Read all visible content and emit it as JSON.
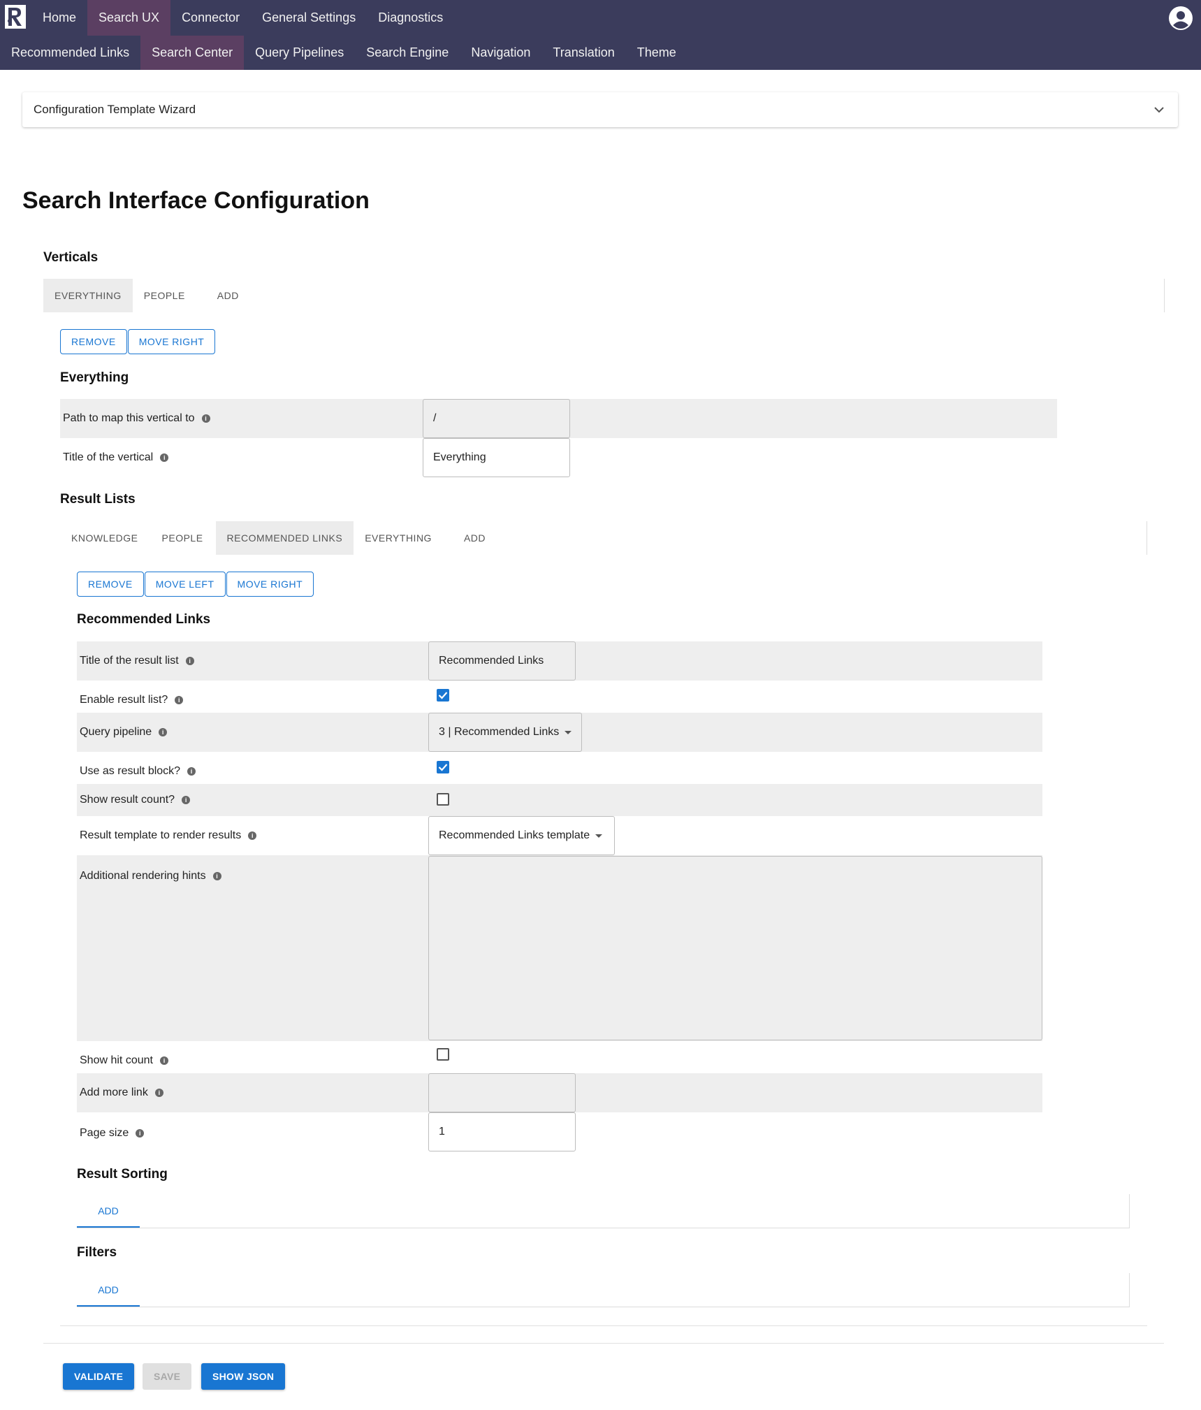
{
  "nav": {
    "primary": [
      "Home",
      "Search UX",
      "Connector",
      "General Settings",
      "Diagnostics"
    ],
    "secondary": [
      "Recommended Links",
      "Search Center",
      "Query Pipelines",
      "Search Engine",
      "Navigation",
      "Translation",
      "Theme"
    ]
  },
  "wizard": {
    "label": "Configuration Template Wizard"
  },
  "page": {
    "title": "Search Interface Configuration"
  },
  "verticals": {
    "title": "Verticals",
    "tabs": [
      "EVERYTHING",
      "PEOPLE",
      "ADD"
    ],
    "buttons": {
      "remove": "REMOVE",
      "move_right": "MOVE RIGHT"
    },
    "selected_title": "Everything",
    "fields": {
      "path_label": "Path to map this vertical to",
      "path_value": "/",
      "title_label": "Title of the vertical",
      "title_value": "Everything"
    }
  },
  "result_lists": {
    "title": "Result Lists",
    "tabs": [
      "KNOWLEDGE",
      "PEOPLE",
      "RECOMMENDED LINKS",
      "EVERYTHING",
      "ADD"
    ],
    "buttons": {
      "remove": "REMOVE",
      "move_left": "MOVE LEFT",
      "move_right": "MOVE RIGHT"
    },
    "selected_title": "Recommended Links",
    "fields": {
      "title_label": "Title of the result list",
      "title_value": "Recommended Links",
      "enable_label": "Enable result list?",
      "enable_checked": true,
      "pipeline_label": "Query pipeline",
      "pipeline_value": "3 | Recommended Links",
      "block_label": "Use as result block?",
      "block_checked": true,
      "count_label": "Show result count?",
      "count_checked": false,
      "template_label": "Result template to render results",
      "template_value": "Recommended Links template",
      "hints_label": "Additional rendering hints",
      "hints_value": "",
      "hit_label": "Show hit count",
      "hit_checked": false,
      "more_label": "Add more link",
      "more_value": "",
      "page_label": "Page size",
      "page_value": "1"
    }
  },
  "sorting": {
    "title": "Result Sorting",
    "add": "ADD"
  },
  "filters": {
    "title": "Filters",
    "add": "ADD"
  },
  "actions": {
    "validate": "VALIDATE",
    "save": "SAVE",
    "show_json": "SHOW JSON"
  }
}
